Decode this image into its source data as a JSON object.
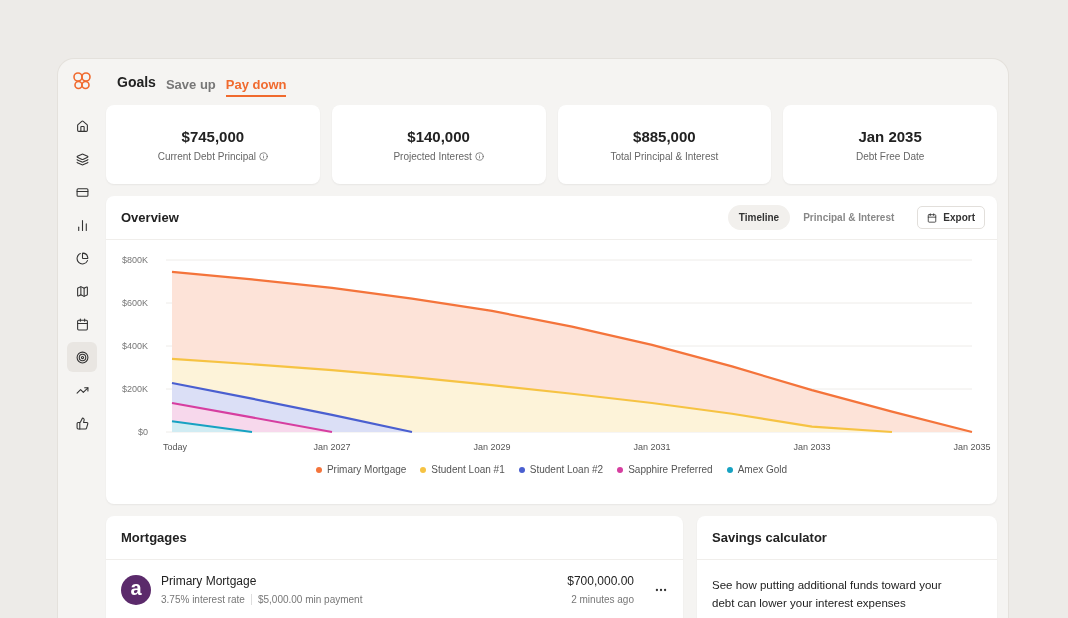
{
  "header": {
    "title": "Goals",
    "tabs": [
      {
        "label": "Save up",
        "selected": false
      },
      {
        "label": "Pay down",
        "selected": true
      }
    ]
  },
  "sidebar": {
    "items": [
      {
        "selected": false
      },
      {
        "selected": false
      },
      {
        "selected": false
      },
      {
        "selected": false
      },
      {
        "selected": false
      },
      {
        "selected": false
      },
      {
        "selected": false
      },
      {
        "selected": true
      },
      {
        "selected": false
      },
      {
        "selected": false
      }
    ]
  },
  "stats": [
    {
      "value": "$745,000",
      "label": "Current Debt Principal",
      "info": true
    },
    {
      "value": "$140,000",
      "label": "Projected Interest",
      "info": true
    },
    {
      "value": "$885,000",
      "label": "Total Principal & Interest",
      "info": false
    },
    {
      "value": "Jan 2035",
      "label": "Debt Free Date",
      "info": false
    }
  ],
  "overview": {
    "title": "Overview",
    "views": [
      {
        "label": "Timeline",
        "selected": true
      },
      {
        "label": "Principal & Interest",
        "selected": false
      }
    ],
    "export_label": "Export",
    "chart_data": {
      "type": "area",
      "categories": [
        "Today",
        null,
        "Jan 2027",
        null,
        "Jan 2029",
        null,
        "Jan 2031",
        null,
        "Jan 2033",
        null,
        "Jan 2035"
      ],
      "ylim": [
        0,
        800000
      ],
      "yticks": [
        {
          "value": 0,
          "label": "$0"
        },
        {
          "value": 200000,
          "label": "$200K"
        },
        {
          "value": 400000,
          "label": "$400K"
        },
        {
          "value": 600000,
          "label": "$600K"
        },
        {
          "value": 800000,
          "label": "$800K"
        }
      ],
      "stacked": false,
      "grid": true,
      "series": [
        {
          "name": "Primary Mortgage",
          "color": "#f4743b",
          "values": [
            745000,
            710000,
            670000,
            620000,
            563000,
            490000,
            405000,
            305000,
            195000,
            95000,
            0
          ]
        },
        {
          "name": "Student Loan #1",
          "color": "#f6c343",
          "values": [
            340000,
            315000,
            288000,
            255000,
            218000,
            178000,
            135000,
            85000,
            25000,
            0,
            null
          ]
        },
        {
          "name": "Student Loan #2",
          "color": "#4a5fd0",
          "values": [
            228000,
            155000,
            80000,
            0,
            null,
            null,
            null,
            null,
            null,
            null,
            null
          ]
        },
        {
          "name": "Sapphire Preferred",
          "color": "#d63ea0",
          "values": [
            135000,
            68000,
            0,
            null,
            null,
            null,
            null,
            null,
            null,
            null,
            null
          ]
        },
        {
          "name": "Amex Gold",
          "color": "#17a2c2",
          "values": [
            50000,
            0,
            null,
            null,
            null,
            null,
            null,
            null,
            null,
            null,
            null
          ]
        }
      ]
    }
  },
  "mortgages": {
    "title": "Mortgages",
    "rows": [
      {
        "logo_text": "a",
        "name": "Primary Mortgage",
        "rate": "3.75% interest rate",
        "payment": "$5,000.00 min payment",
        "amount": "$700,000.00",
        "updated": "2 minutes ago"
      }
    ]
  },
  "savings": {
    "title": "Savings calculator",
    "text": "See how putting additional funds toward your debt can lower your interest expenses"
  }
}
